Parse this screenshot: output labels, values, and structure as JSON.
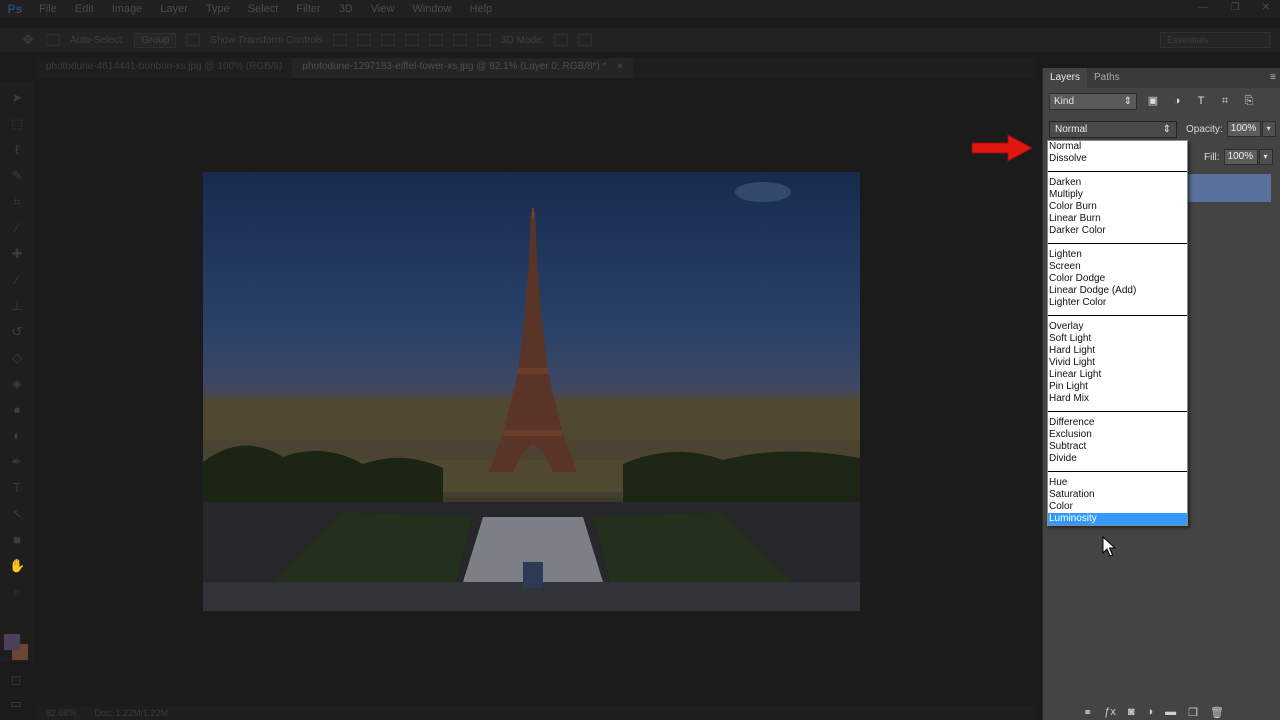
{
  "app": {
    "logo": "Ps",
    "menu": [
      "File",
      "Edit",
      "Image",
      "Layer",
      "Type",
      "Select",
      "Filter",
      "3D",
      "View",
      "Window",
      "Help"
    ],
    "window_controls": [
      "—",
      "❐",
      "✕"
    ]
  },
  "options_bar": {
    "auto_select_label": "Auto-Select:",
    "auto_select_value": "Group",
    "show_transform_label": "Show Transform Controls",
    "mode_label": "3D Mode:",
    "workspace": "Essentials"
  },
  "document_tabs": [
    {
      "label": "photodune-4614441-bonbon-xs.jpg @ 100% (RGB/8)",
      "active": false
    },
    {
      "label": "photodune-1297183-eiffel-tower-xs.jpg @ 82.1% (Layer 0, RGB/8*) *",
      "active": true
    }
  ],
  "status_bar": {
    "zoom": "82.08%",
    "doc_size": "Doc: 1.22M/1.22M"
  },
  "layers_panel": {
    "tabs": [
      "Layers",
      "Paths"
    ],
    "filter_kind": "Kind",
    "blend_mode_selected": "Normal",
    "opacity_label": "Opacity:",
    "opacity_value": "100%",
    "fill_label": "Fill:",
    "fill_value": "100%"
  },
  "blend_modes": {
    "groups": [
      [
        "Normal",
        "Dissolve"
      ],
      [
        "Darken",
        "Multiply",
        "Color Burn",
        "Linear Burn",
        "Darker Color"
      ],
      [
        "Lighten",
        "Screen",
        "Color Dodge",
        "Linear Dodge (Add)",
        "Lighter Color"
      ],
      [
        "Overlay",
        "Soft Light",
        "Hard Light",
        "Vivid Light",
        "Linear Light",
        "Pin Light",
        "Hard Mix"
      ],
      [
        "Difference",
        "Exclusion",
        "Subtract",
        "Divide"
      ],
      [
        "Hue",
        "Saturation",
        "Color",
        "Luminosity"
      ]
    ],
    "highlighted": "Luminosity"
  },
  "colors": {
    "highlight": "#3399ff",
    "annotation_arrow": "#e0170f",
    "layer_selected": "#58709a"
  },
  "icons": {
    "arrow_annotation": "red-arrow-icon",
    "cursor": "mouse-cursor-icon"
  }
}
